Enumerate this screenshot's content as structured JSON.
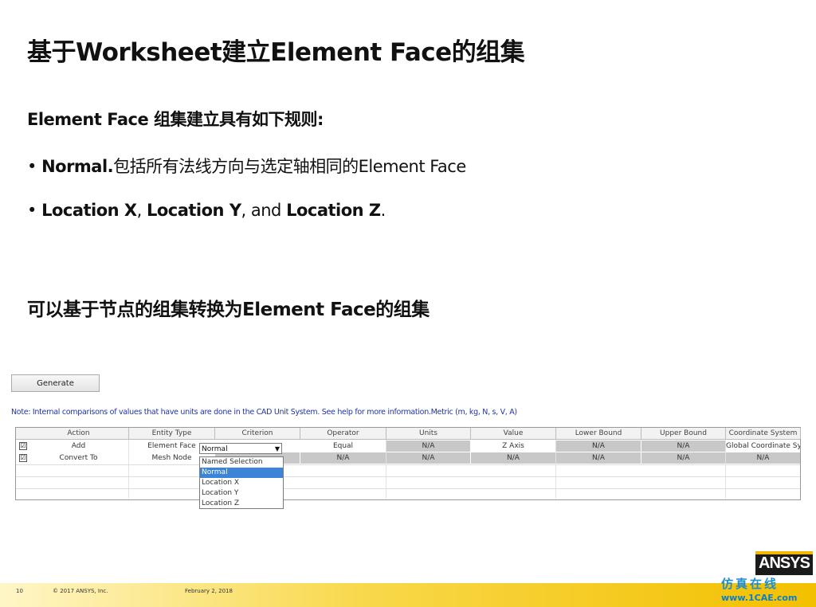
{
  "slide": {
    "title": "基于Worksheet建立Element  Face的组集",
    "intro": "Element Face 组集建立具有如下规则:",
    "bullet1": {
      "bold": "Normal.",
      "rest": "包括所有法线方向与选定轴相同的Element Face"
    },
    "bullet2": {
      "p1": "Location X",
      "s1": ", ",
      "p2": "Location Y",
      "s2": ", and ",
      "p3": "Location Z",
      "s3": "."
    },
    "subtitle": "可以基于节点的组集转换为Element Face的组集"
  },
  "worksheet": {
    "generate_label": "Generate",
    "note": "Note: Internal comparisons of values that have units are done in the CAD Unit System. See help for more information.Metric (m, kg, N, s, V, A)",
    "columns": [
      "Action",
      "Entity Type",
      "Criterion",
      "Operator",
      "Units",
      "Value",
      "Lower Bound",
      "Upper Bound",
      "Coordinate System"
    ],
    "rows": [
      {
        "checked": "☑",
        "action": "Add",
        "entity": "Element Face",
        "criterion": "Normal",
        "operator": "Equal",
        "units": "N/A",
        "value": "Z Axis",
        "lower": "N/A",
        "upper": "N/A",
        "coord": "Global Coordinate System"
      },
      {
        "checked": "☑",
        "action": "Convert To",
        "entity": "Mesh Node",
        "criterion": "",
        "operator": "N/A",
        "units": "N/A",
        "value": "N/A",
        "lower": "N/A",
        "upper": "N/A",
        "coord": "N/A"
      }
    ],
    "dropdown_arrow": "▼",
    "dropdown_options": [
      "Named Selection",
      "Normal",
      "Location X",
      "Location Y",
      "Location Z"
    ],
    "dropdown_selected": "Normal"
  },
  "footer": {
    "page": "10",
    "copyright": "© 2017 ANSYS, Inc.",
    "date": "February 2, 2018",
    "logo": "ANSYS",
    "site_cn": "仿真在线",
    "site_url": "www.1CAE.com"
  }
}
